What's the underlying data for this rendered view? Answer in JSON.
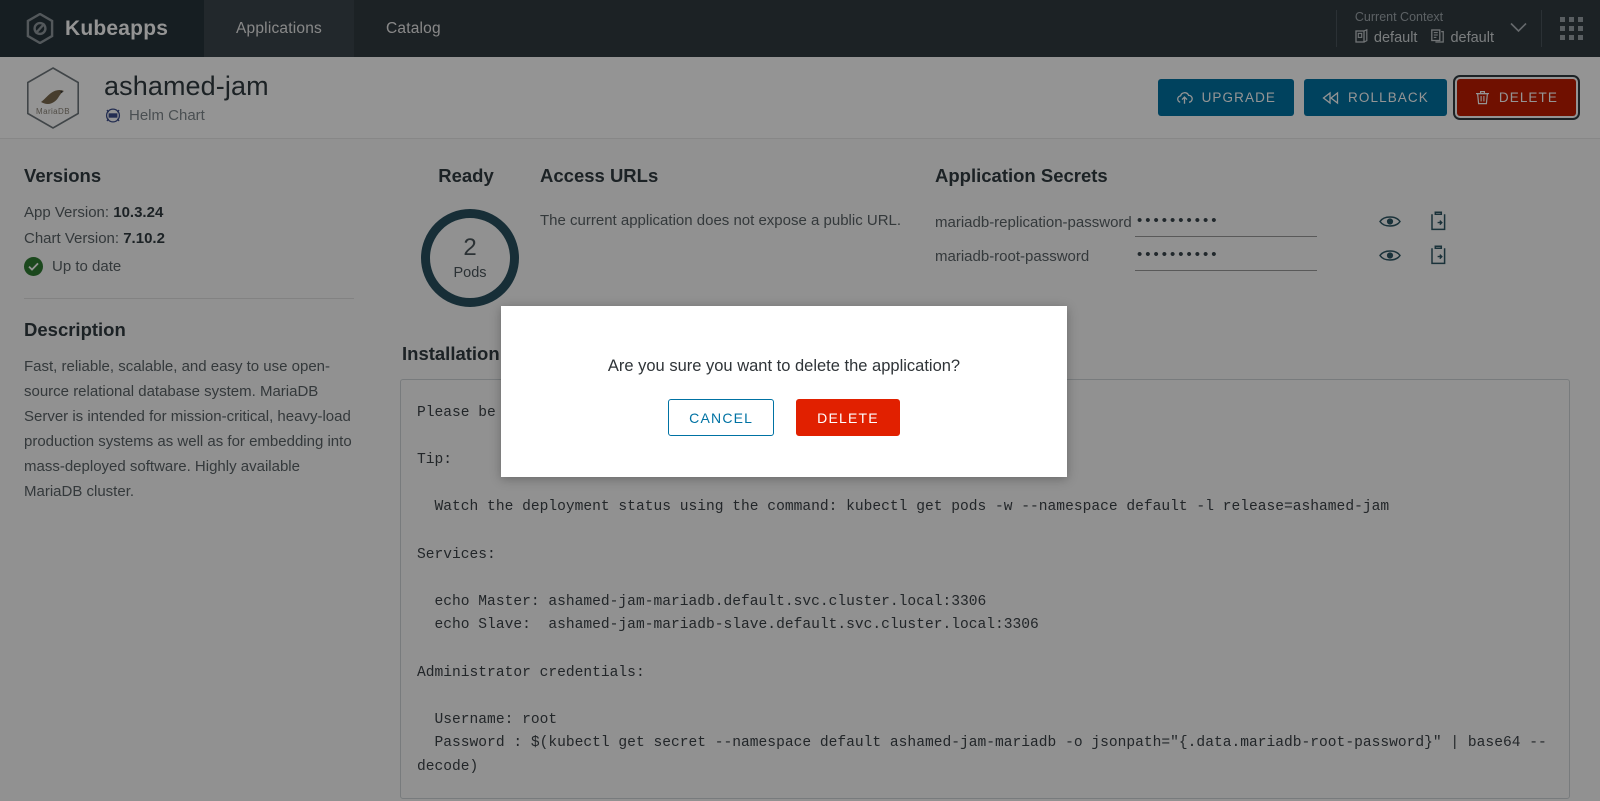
{
  "header": {
    "brand": "Kubeapps",
    "brand_logo_icon": "kubeapps-hexagon-logo",
    "nav": [
      {
        "label": "Applications",
        "active": true
      },
      {
        "label": "Catalog",
        "active": false
      }
    ],
    "context": {
      "title": "Current Context",
      "cluster_icon": "cluster-icon",
      "cluster": "default",
      "namespace_icon": "namespace-icon",
      "namespace": "default",
      "chevron_icon": "chevron-down-icon"
    },
    "grid_icon": "apps-grid-icon"
  },
  "app": {
    "logo_icon": "mariadb-hexagon-logo",
    "logo_text": "MariaDB",
    "title": "ashamed-jam",
    "type_icon": "helm-icon",
    "type_label": "Helm Chart",
    "actions": [
      {
        "label": "UPGRADE",
        "icon": "cloud-upload-icon",
        "style": "primary"
      },
      {
        "label": "ROLLBACK",
        "icon": "rewind-icon",
        "style": "primary"
      },
      {
        "label": "DELETE",
        "icon": "trash-icon",
        "style": "danger",
        "focused": true
      }
    ]
  },
  "sidebar": {
    "versions_heading": "Versions",
    "app_version_label": "App Version:",
    "app_version": "10.3.24",
    "chart_version_label": "Chart Version:",
    "chart_version": "7.10.2",
    "status_icon": "check-circle-icon",
    "status": "Up to date",
    "description_heading": "Description",
    "description": "Fast, reliable, scalable, and easy to use open-source relational database system. MariaDB Server is intended for mission-critical, heavy-load production systems as well as for embedding into mass-deployed software. Highly available MariaDB cluster."
  },
  "main": {
    "ready": {
      "heading": "Ready",
      "count": "2",
      "unit": "Pods"
    },
    "access_urls": {
      "heading": "Access URLs",
      "message": "The current application does not expose a public URL."
    },
    "secrets": {
      "heading": "Application Secrets",
      "rows": [
        {
          "name": "mariadb-replication-password",
          "value": "••••••••••",
          "reveal_icon": "eye-icon",
          "copy_icon": "clipboard-copy-icon"
        },
        {
          "name": "mariadb-root-password",
          "value": "••••••••••",
          "reveal_icon": "eye-icon",
          "copy_icon": "clipboard-copy-icon"
        }
      ]
    },
    "installation_notes": {
      "heading": "Installation Notes",
      "body": "Please be patient while the chart is being deployed\n\nTip:\n\n  Watch the deployment status using the command: kubectl get pods -w --namespace default -l release=ashamed-jam\n\nServices:\n\n  echo Master: ashamed-jam-mariadb.default.svc.cluster.local:3306\n  echo Slave:  ashamed-jam-mariadb-slave.default.svc.cluster.local:3306\n\nAdministrator credentials:\n\n  Username: root\n  Password : $(kubectl get secret --namespace default ashamed-jam-mariadb -o jsonpath=\"{.data.mariadb-root-password}\" | base64 --decode)"
    }
  },
  "modal": {
    "message": "Are you sure you want to delete the application?",
    "cancel_label": "CANCEL",
    "delete_label": "DELETE"
  },
  "colors": {
    "header_bg": "#313b41",
    "brand_bg": "#26343c",
    "primary": "#0072a3",
    "danger": "#c21d00",
    "modal_danger": "#e12000",
    "ring": "#29505f",
    "success": "#2f7d32"
  }
}
